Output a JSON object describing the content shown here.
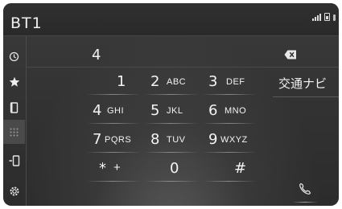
{
  "header": {
    "title": "BT1",
    "status_icons": [
      "signal-icon",
      "battery-icon",
      "indicator-icon"
    ]
  },
  "sidebar": {
    "items": [
      {
        "icon": "history-icon"
      },
      {
        "icon": "star-icon"
      },
      {
        "icon": "phonebook-icon"
      },
      {
        "icon": "keypad-icon"
      },
      {
        "icon": "phone-transfer-icon"
      },
      {
        "icon": "settings-icon"
      }
    ]
  },
  "dialer": {
    "number": "4",
    "backspace_icon": "backspace-icon",
    "keys": [
      {
        "digit": "1",
        "letters": ""
      },
      {
        "digit": "2",
        "letters": "ABC"
      },
      {
        "digit": "3",
        "letters": "DEF"
      },
      {
        "digit": "4",
        "letters": "GHI"
      },
      {
        "digit": "5",
        "letters": "JKL"
      },
      {
        "digit": "6",
        "letters": "MNO"
      },
      {
        "digit": "7",
        "letters": "PQRS"
      },
      {
        "digit": "8",
        "letters": "TUV"
      },
      {
        "digit": "9",
        "letters": "WXYZ"
      },
      {
        "digit": "*",
        "letters": "+"
      },
      {
        "digit": "0",
        "letters": ""
      },
      {
        "digit": "#",
        "letters": ""
      }
    ]
  },
  "side_actions": {
    "navi_label": "交通ナビ",
    "call_icon": "phone-call-icon"
  },
  "colors": {
    "background": "#333333",
    "text": "#f2f2f2",
    "divider": "#4a4a4a"
  }
}
